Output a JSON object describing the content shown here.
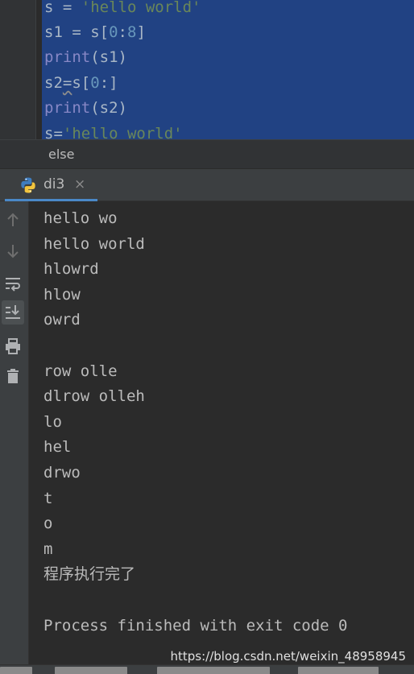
{
  "editor": {
    "lines": [
      {
        "parts": [
          {
            "t": "s = ",
            "c": ""
          },
          {
            "t": "'hello world'",
            "c": "str"
          }
        ]
      },
      {
        "parts": [
          {
            "t": "s1 = s[",
            "c": ""
          },
          {
            "t": "0",
            "c": "num"
          },
          {
            "t": ":",
            "c": ""
          },
          {
            "t": "8",
            "c": "num"
          },
          {
            "t": "]",
            "c": ""
          }
        ]
      },
      {
        "parts": [
          {
            "t": "print",
            "c": "fn"
          },
          {
            "t": "(s1)",
            "c": ""
          }
        ]
      },
      {
        "parts": [
          {
            "t": "s2",
            "c": ""
          },
          {
            "t": "=",
            "c": "squig"
          },
          {
            "t": "s[",
            "c": ""
          },
          {
            "t": "0",
            "c": "num"
          },
          {
            "t": ":]",
            "c": ""
          }
        ]
      },
      {
        "parts": [
          {
            "t": "print",
            "c": "fn"
          },
          {
            "t": "(s2)",
            "c": ""
          }
        ]
      },
      {
        "parts": [
          {
            "t": "s=",
            "c": ""
          },
          {
            "t": "'hello world'",
            "c": "str"
          }
        ]
      }
    ]
  },
  "breadcrumb": {
    "text": "else"
  },
  "run_tab": {
    "label": "di3",
    "close": "×"
  },
  "toolbar": {
    "icons": [
      "arrow-up-icon",
      "arrow-down-icon",
      "soft-wrap-icon",
      "scroll-to-end-icon",
      "print-icon",
      "trash-icon"
    ]
  },
  "console": {
    "lines": [
      "hello wo",
      "hello world",
      "hlowrd",
      "hlow",
      "owrd",
      "",
      "row olle",
      "dlrow olleh",
      "lo",
      "hel",
      "drwo",
      "t",
      "o",
      "m",
      "程序执行完了",
      "",
      "Process finished with exit code 0"
    ]
  },
  "watermark": "https://blog.csdn.net/weixin_48958945",
  "colors": {
    "background": "#2b2b2b",
    "selection": "#214283",
    "string": "#6a8759",
    "number": "#6897bb",
    "builtin": "#8888c6",
    "tab_underline": "#4a88c7"
  }
}
